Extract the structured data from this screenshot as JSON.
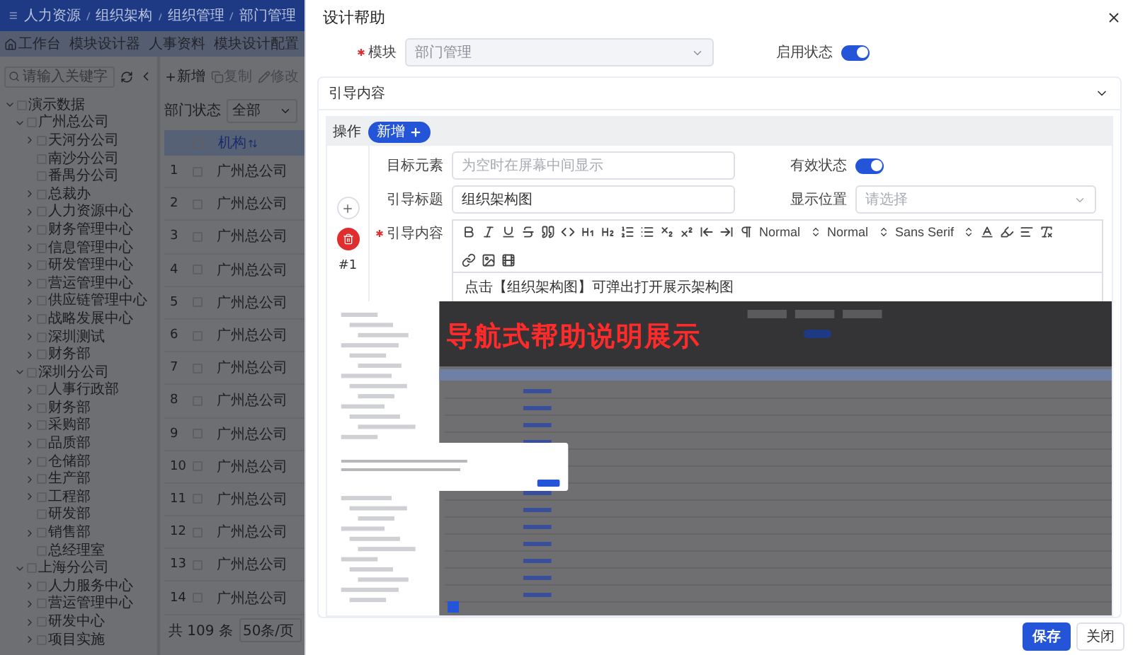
{
  "header": {
    "breadcrumb": [
      "人力资源",
      "组织架构",
      "组织管理",
      "部门管理"
    ]
  },
  "tabs": [
    {
      "label": "工作台",
      "kind": "home",
      "selected": false
    },
    {
      "label": "模块设计器",
      "kind": "plain",
      "selected": false
    },
    {
      "label": "人事资料",
      "kind": "plain",
      "selected": false
    },
    {
      "label": "模块设计配置",
      "kind": "plain",
      "selected": false
    }
  ],
  "tree_search": {
    "placeholder": "请输入关键字"
  },
  "toolbar": [
    {
      "label": "新增",
      "kind": "add",
      "disabled": false
    },
    {
      "label": "复制",
      "kind": "copy",
      "disabled": true
    },
    {
      "label": "修改",
      "kind": "edit",
      "disabled": true
    }
  ],
  "filter": {
    "label": "部门状态",
    "value": "全部"
  },
  "tree": [
    {
      "label": "演示数据",
      "checked": false,
      "expanded": true,
      "children": [
        {
          "label": "广州总公司",
          "checked": false,
          "expanded": true,
          "children": [
            {
              "label": "天河分公司",
              "checked": false,
              "expanded": false
            },
            {
              "label": "南沙分公司",
              "checked": false
            },
            {
              "label": "番禺分公司",
              "checked": false
            },
            {
              "label": "总裁办",
              "checked": false,
              "expanded": false
            },
            {
              "label": "人力资源中心",
              "checked": false,
              "expanded": false
            },
            {
              "label": "财务管理中心",
              "checked": false,
              "expanded": false
            },
            {
              "label": "信息管理中心",
              "checked": false,
              "expanded": false
            },
            {
              "label": "研发管理中心",
              "checked": false,
              "expanded": false
            },
            {
              "label": "营运管理中心",
              "checked": false,
              "expanded": false
            },
            {
              "label": "供应链管理中心",
              "checked": false,
              "expanded": false
            },
            {
              "label": "战略发展中心",
              "checked": false,
              "expanded": false
            },
            {
              "label": "深圳测试",
              "checked": false,
              "expanded": false
            },
            {
              "label": "财务部",
              "checked": false,
              "expanded": false
            }
          ]
        },
        {
          "label": "深圳分公司",
          "checked": false,
          "expanded": true,
          "children": [
            {
              "label": "人事行政部",
              "checked": false,
              "expanded": false
            },
            {
              "label": "财务部",
              "checked": false,
              "expanded": false
            },
            {
              "label": "采购部",
              "checked": false,
              "expanded": false
            },
            {
              "label": "品质部",
              "checked": false,
              "expanded": false
            },
            {
              "label": "仓储部",
              "checked": false,
              "expanded": false
            },
            {
              "label": "生产部",
              "checked": false,
              "expanded": false
            },
            {
              "label": "工程部",
              "checked": false,
              "expanded": false
            },
            {
              "label": "研发部",
              "checked": false
            },
            {
              "label": "销售部",
              "checked": false,
              "expanded": false
            },
            {
              "label": "总经理室",
              "checked": false
            }
          ]
        },
        {
          "label": "上海分公司",
          "checked": false,
          "expanded": true,
          "children": [
            {
              "label": "人力服务中心",
              "checked": false,
              "expanded": false
            },
            {
              "label": "营运管理中心",
              "checked": false,
              "expanded": false
            },
            {
              "label": "研发中心",
              "checked": false,
              "expanded": false
            },
            {
              "label": "项目实施",
              "checked": false,
              "expanded": false
            }
          ]
        }
      ]
    }
  ],
  "table": {
    "all_checked": false,
    "columns": [
      "机构"
    ],
    "rows": [
      {
        "index": "1",
        "org": "广州总公司",
        "checked": false
      },
      {
        "index": "2",
        "org": "广州总公司",
        "checked": false
      },
      {
        "index": "3",
        "org": "广州总公司",
        "checked": false
      },
      {
        "index": "4",
        "org": "广州总公司",
        "checked": false
      },
      {
        "index": "5",
        "org": "广州总公司",
        "checked": false
      },
      {
        "index": "6",
        "org": "广州总公司",
        "checked": false
      },
      {
        "index": "7",
        "org": "广州总公司",
        "checked": false
      },
      {
        "index": "8",
        "org": "广州总公司",
        "checked": false
      },
      {
        "index": "9",
        "org": "广州总公司",
        "checked": false
      },
      {
        "index": "10",
        "org": "广州总公司",
        "checked": false
      },
      {
        "index": "11",
        "org": "广州总公司",
        "checked": false
      },
      {
        "index": "12",
        "org": "广州总公司",
        "checked": false
      },
      {
        "index": "13",
        "org": "广州总公司",
        "checked": false
      },
      {
        "index": "14",
        "org": "广州总公司",
        "checked": false
      }
    ]
  },
  "pagination": {
    "total": "共 109 条",
    "page_size": "50条/页"
  },
  "dialog": {
    "title": "设计帮助",
    "module": {
      "label": "模块",
      "required": true,
      "value": "部门管理",
      "disabled": true
    },
    "enabled": {
      "label": "启用状态",
      "on": true
    },
    "section": {
      "title": "引导内容",
      "expanded": true
    },
    "steps_header": {
      "label": "操作",
      "add_button": "新增"
    },
    "steps": [
      {
        "number": "#1",
        "target": {
          "label": "目标元素",
          "placeholder": "为空时在屏幕中间显示"
        },
        "valid": {
          "label": "有效状态",
          "on": true
        },
        "title": {
          "label": "引导标题",
          "value": "组织架构图"
        },
        "position": {
          "label": "显示位置",
          "placeholder": "请选择"
        },
        "content": {
          "label": "引导内容",
          "required": true,
          "toolbar_selects": [
            "Normal",
            "Normal",
            "Sans Serif"
          ],
          "text": "点击【组织架构图】可弹出打开展示架构图",
          "image": {
            "kind": "picture",
            "caption": "导航式帮助说明展示"
          }
        }
      }
    ],
    "buttons": [
      {
        "label": "保存",
        "kind": "primary"
      },
      {
        "label": "关闭",
        "kind": "default"
      }
    ]
  }
}
